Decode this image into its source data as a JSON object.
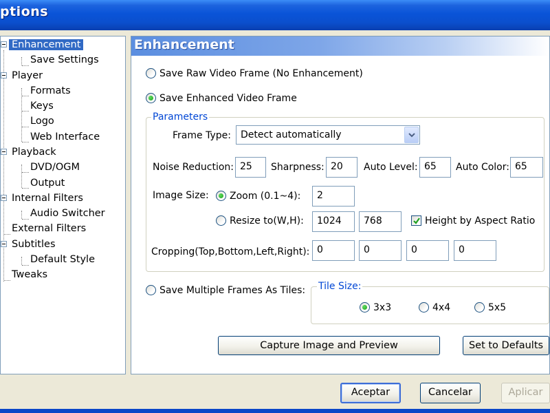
{
  "window": {
    "title": "ptions"
  },
  "tree": {
    "items": [
      {
        "label": "Enhancement",
        "level": 0,
        "selected": true
      },
      {
        "label": "Save Settings",
        "level": 1
      },
      {
        "label": "Player",
        "level": 0
      },
      {
        "label": "Formats",
        "level": 1
      },
      {
        "label": "Keys",
        "level": 1
      },
      {
        "label": "Logo",
        "level": 1
      },
      {
        "label": "Web Interface",
        "level": 1
      },
      {
        "label": "Playback",
        "level": 0
      },
      {
        "label": "DVD/OGM",
        "level": 1
      },
      {
        "label": "Output",
        "level": 1
      },
      {
        "label": "Internal Filters",
        "level": 0
      },
      {
        "label": "Audio Switcher",
        "level": 1
      },
      {
        "label": "External Filters",
        "level": 0
      },
      {
        "label": "Subtitles",
        "level": 0
      },
      {
        "label": "Default Style",
        "level": 1
      },
      {
        "label": "Tweaks",
        "level": 0
      }
    ]
  },
  "panel": {
    "header": "Enhancement",
    "save_raw": {
      "label": "Save Raw Video Frame (No Enhancement)",
      "checked": false
    },
    "save_enhanced": {
      "label": "Save Enhanced Video Frame",
      "checked": true
    },
    "parameters": {
      "title": "Parameters",
      "frame_type": {
        "label": "Frame Type:",
        "value": "Detect automatically"
      },
      "noise_reduction": {
        "label": "Noise Reduction:",
        "value": "25"
      },
      "sharpness": {
        "label": "Sharpness:",
        "value": "20"
      },
      "auto_level": {
        "label": "Auto Level:",
        "value": "65"
      },
      "auto_color": {
        "label": "Auto Color:",
        "value": "65"
      },
      "image_size": {
        "label": "Image Size:",
        "zoom": {
          "label": "Zoom (0.1~4):",
          "value": "2",
          "checked": true
        },
        "resize": {
          "label": "Resize to(W,H):",
          "width": "1024",
          "height": "768",
          "checked": false
        },
        "aspect": {
          "label": "Height by Aspect Ratio",
          "checked": true
        }
      },
      "cropping": {
        "label": "Cropping(Top,Bottom,Left,Right):",
        "top": "0",
        "bottom": "0",
        "left": "0",
        "right": "0"
      }
    },
    "save_tiles": {
      "label": "Save Multiple Frames As Tiles:",
      "checked": false
    },
    "tile_size": {
      "title": "Tile Size:",
      "options": [
        {
          "label": "3x3",
          "checked": true
        },
        {
          "label": "4x4",
          "checked": false
        },
        {
          "label": "5x5",
          "checked": false
        }
      ]
    },
    "capture_button": "Capture Image and Preview",
    "defaults_button": "Set to Defaults"
  },
  "footer": {
    "ok": "Aceptar",
    "cancel": "Cancelar",
    "apply": "Aplicar"
  }
}
